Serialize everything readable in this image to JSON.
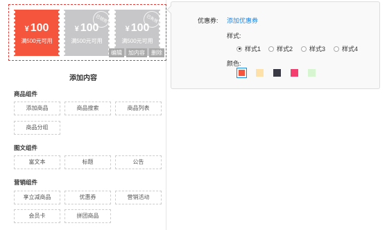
{
  "preview": {
    "coupons": [
      {
        "currency": "¥",
        "amount": "100",
        "condition": "满500元可用",
        "stamp": "",
        "color": "#f5543d"
      },
      {
        "currency": "¥",
        "amount": "100",
        "condition": "满500元可用",
        "stamp": "已领完",
        "color": "#c7c7c9"
      },
      {
        "currency": "¥",
        "amount": "100",
        "condition": "满500元可用",
        "stamp": "已失效",
        "color": "#c7c7c9"
      }
    ],
    "actions": {
      "edit": "编辑",
      "add": "加内容",
      "delete": "删除"
    }
  },
  "add_content": {
    "title": "添加内容",
    "groups": [
      {
        "title": "商品组件",
        "items": [
          "添加商品",
          "商品搜索",
          "商品列表",
          "商品分组"
        ]
      },
      {
        "title": "图文组件",
        "items": [
          "富文本",
          "标题",
          "公告"
        ]
      },
      {
        "title": "营销组件",
        "items": [
          "享立减商品",
          "优惠券",
          "营销活动",
          "会员卡",
          "拼团商品"
        ]
      }
    ]
  },
  "settings": {
    "coupon_label": "优惠券:",
    "add_coupon_link": "添加优惠券",
    "style_label": "样式:",
    "styles": [
      "样式1",
      "样式2",
      "样式3",
      "样式4"
    ],
    "selected_style": "样式1",
    "color_label": "颜色:",
    "colors": [
      "#f5543d",
      "#fde1a8",
      "#3a3a44",
      "#f33e6f",
      "#d6f5d0"
    ],
    "selected_color": "#f5543d"
  }
}
